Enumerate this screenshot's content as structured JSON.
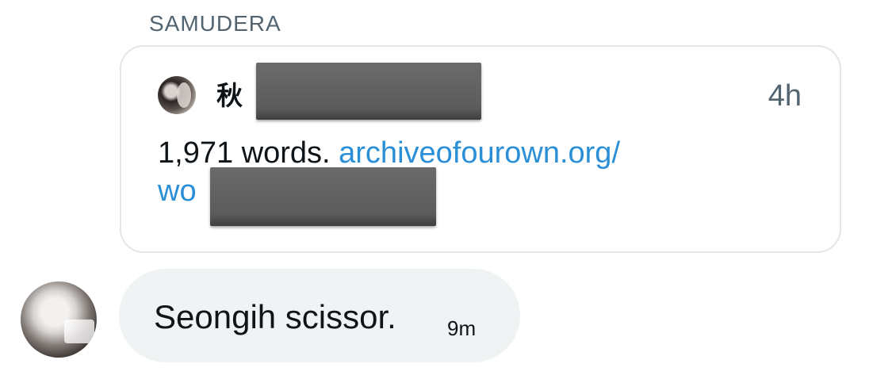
{
  "conversation": {
    "sender_name": "SAMUDERA"
  },
  "quote": {
    "author_visible": "秋",
    "time": "4h",
    "text": "1,971 words. ",
    "link_line1": "archiveofourown.org/",
    "link_line2": "wo"
  },
  "message": {
    "text": "Seongih scissor.",
    "time": "9m"
  },
  "colors": {
    "link": "#2a8fd6",
    "bubble": "#eff3f4",
    "muted": "#536471"
  }
}
